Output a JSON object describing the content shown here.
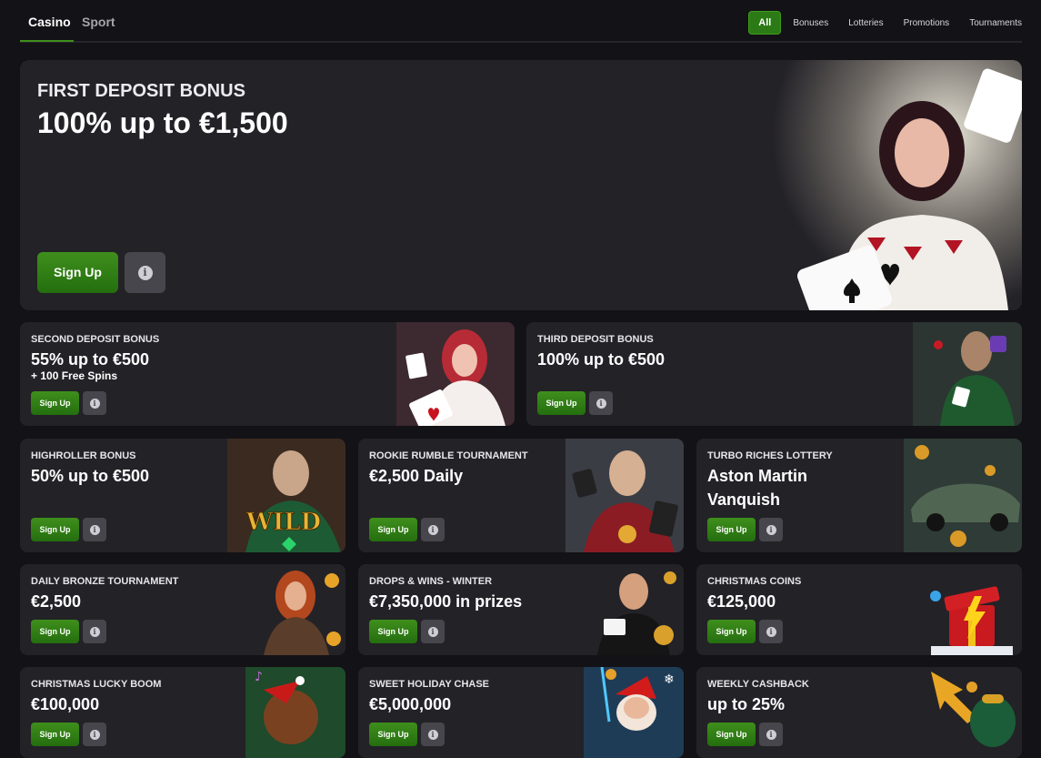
{
  "nav": {
    "tabs": [
      "Casino",
      "Sport"
    ],
    "filters": [
      "All",
      "Bonuses",
      "Lotteries",
      "Promotions",
      "Tournaments"
    ]
  },
  "hero": {
    "eyebrow": "FIRST DEPOSIT BONUS",
    "title": "100% up to €1,500",
    "button": "Sign Up",
    "info": "i"
  },
  "cards": [
    {
      "eyebrow": "SECOND DEPOSIT BONUS",
      "title": "55% up to €500",
      "sub": "+ 100 Free Spins",
      "button": "Sign Up",
      "info": "i"
    },
    {
      "eyebrow": "THIRD DEPOSIT BONUS",
      "title": "100% up to €500",
      "button": "Sign Up",
      "info": "i"
    },
    {
      "eyebrow": "HIGHROLLER BONUS",
      "title": "50% up to €500",
      "button": "Sign Up",
      "info": "i",
      "art_text": "WILD"
    },
    {
      "eyebrow": "ROOKIE RUMBLE TOURNAMENT",
      "title": "€2,500 Daily",
      "button": "Sign Up",
      "info": "i"
    },
    {
      "eyebrow": "TURBO RICHES LOTTERY",
      "title": "Aston Martin Vanquish",
      "button": "Sign Up",
      "info": "i"
    },
    {
      "eyebrow": "DAILY BRONZE TOURNAMENT",
      "title": "€2,500",
      "button": "Sign Up",
      "info": "i"
    },
    {
      "eyebrow": "DROPS & WINS - WINTER",
      "title": "€7,350,000 in prizes",
      "button": "Sign Up",
      "info": "i"
    },
    {
      "eyebrow": "CHRISTMAS COINS",
      "title": "€125,000",
      "button": "Sign Up",
      "info": "i"
    },
    {
      "eyebrow": "CHRISTMAS LUCKY BOOM",
      "title": "€100,000",
      "button": "Sign Up",
      "info": "i"
    },
    {
      "eyebrow": "SWEET HOLIDAY CHASE",
      "title": "€5,000,000",
      "button": "Sign Up",
      "info": "i"
    },
    {
      "eyebrow": "WEEKLY CASHBACK",
      "title": "up to 25%",
      "button": "Sign Up",
      "info": "i"
    }
  ],
  "colors": {
    "background": "#131216",
    "card": "#232227",
    "accent_green": "#3f8f1c",
    "info_button": "#47464c"
  }
}
